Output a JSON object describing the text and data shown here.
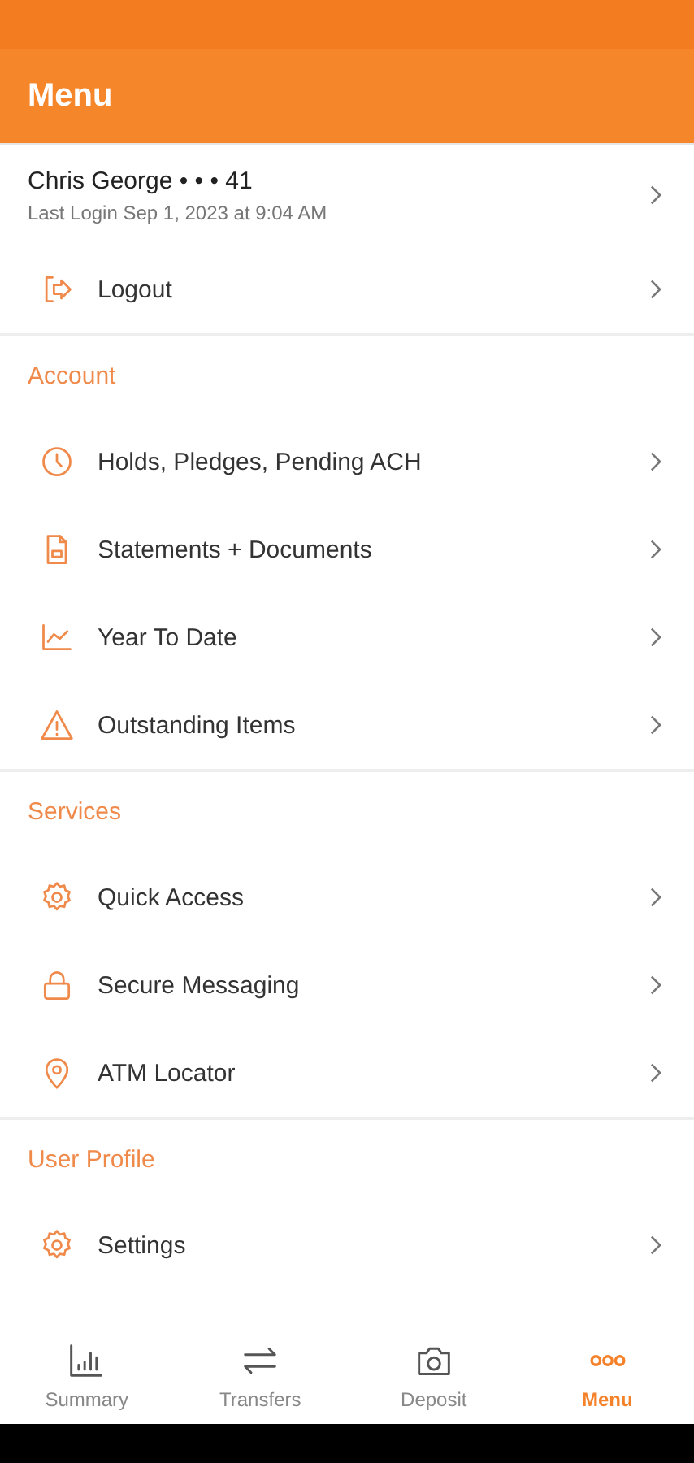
{
  "header": {
    "title": "Menu"
  },
  "profile": {
    "name": "Chris George • • • 41",
    "last_login": "Last Login Sep 1, 2023 at 9:04 AM"
  },
  "logout": {
    "label": "Logout",
    "kind": "logout"
  },
  "sections": [
    {
      "title": "Account",
      "items": [
        {
          "label": "Holds, Pledges, Pending ACH",
          "kind": "clock"
        },
        {
          "label": "Statements + Documents",
          "kind": "document"
        },
        {
          "label": "Year To Date",
          "kind": "chart"
        },
        {
          "label": "Outstanding Items",
          "kind": "warning"
        }
      ]
    },
    {
      "title": "Services",
      "items": [
        {
          "label": "Quick Access",
          "kind": "gear"
        },
        {
          "label": "Secure Messaging",
          "kind": "lock"
        },
        {
          "label": "ATM Locator",
          "kind": "pin"
        }
      ]
    },
    {
      "title": "User Profile",
      "items": [
        {
          "label": "Settings",
          "kind": "gear"
        }
      ]
    }
  ],
  "nav": [
    {
      "label": "Summary",
      "kind": "bars",
      "selected": false
    },
    {
      "label": "Transfers",
      "kind": "arrows",
      "selected": false
    },
    {
      "label": "Deposit",
      "kind": "camera",
      "selected": false
    },
    {
      "label": "Menu",
      "kind": "dots",
      "selected": true
    }
  ]
}
